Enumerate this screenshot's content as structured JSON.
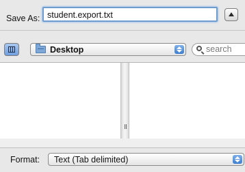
{
  "save_as": {
    "label": "Save As:",
    "filename": "student.export.txt"
  },
  "toolbar": {
    "location": "Desktop",
    "search_placeholder": "search"
  },
  "format": {
    "label": "Format:",
    "value": "Text (Tab delimited)"
  },
  "colors": {
    "focus_ring": "#6f9ccf",
    "popup_stepper": "#3e7fd0",
    "window_bg": "#e8e8e8"
  },
  "icons": {
    "expand": "disclosure-up-icon",
    "view": "column-view-icon",
    "location": "folder-icon",
    "search": "magnifier-icon",
    "popup": "updown-stepper-icon"
  }
}
